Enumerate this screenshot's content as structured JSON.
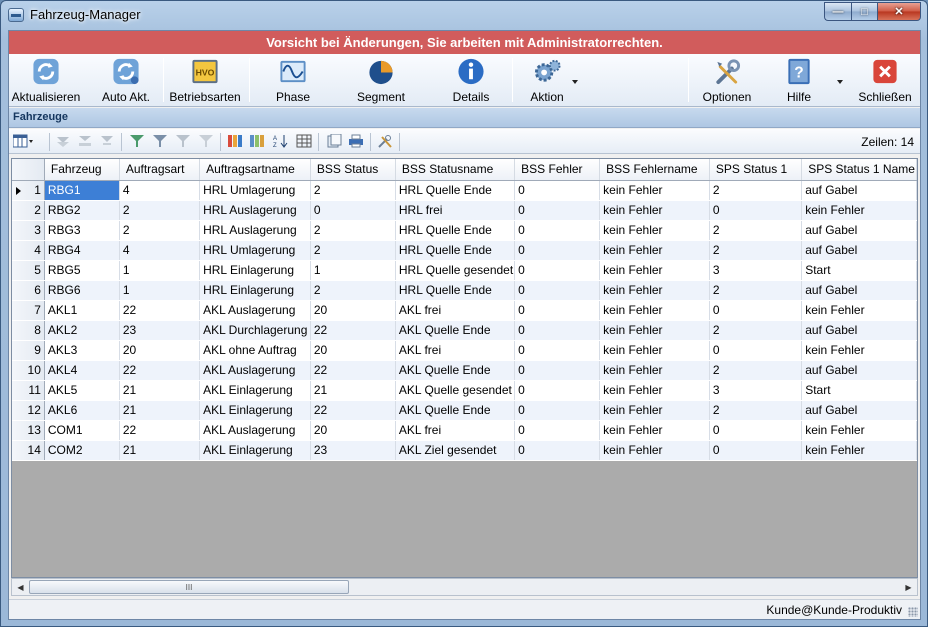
{
  "window": {
    "title": "Fahrzeug-Manager"
  },
  "warning": "Vorsicht bei Änderungen, Sie arbeiten mit Administratorrechten.",
  "toolbar": {
    "aktualisieren": "Aktualisieren",
    "auto_akt": "Auto Akt.",
    "betriebsarten": "Betriebsarten",
    "phase": "Phase",
    "segment": "Segment",
    "details": "Details",
    "aktion": "Aktion",
    "optionen": "Optionen",
    "hilfe": "Hilfe",
    "schliessen": "Schließen",
    "hvo_icon_text": "HVO"
  },
  "section": {
    "title": "Fahrzeuge"
  },
  "grid_toolbar": {
    "rows_label": "Zeilen: 14"
  },
  "table": {
    "columns": [
      "Fahrzeug",
      "Auftragsart",
      "Auftragsartname",
      "BSS Status",
      "BSS Statusname",
      "BSS Fehler",
      "BSS Fehlername",
      "SPS Status 1",
      "SPS Status 1 Name"
    ],
    "rows": [
      [
        "1",
        "RBG1",
        "4",
        "HRL Umlagerung",
        "2",
        "HRL Quelle Ende",
        "0",
        "kein Fehler",
        "2",
        "auf Gabel"
      ],
      [
        "2",
        "RBG2",
        "2",
        "HRL Auslagerung",
        "0",
        "HRL frei",
        "0",
        "kein Fehler",
        "0",
        "kein Fehler"
      ],
      [
        "3",
        "RBG3",
        "2",
        "HRL Auslagerung",
        "2",
        "HRL Quelle Ende",
        "0",
        "kein Fehler",
        "2",
        "auf Gabel"
      ],
      [
        "4",
        "RBG4",
        "4",
        "HRL Umlagerung",
        "2",
        "HRL Quelle Ende",
        "0",
        "kein Fehler",
        "2",
        "auf Gabel"
      ],
      [
        "5",
        "RBG5",
        "1",
        "HRL Einlagerung",
        "1",
        "HRL Quelle gesendet",
        "0",
        "kein Fehler",
        "3",
        "Start"
      ],
      [
        "6",
        "RBG6",
        "1",
        "HRL Einlagerung",
        "2",
        "HRL Quelle Ende",
        "0",
        "kein Fehler",
        "2",
        "auf Gabel"
      ],
      [
        "7",
        "AKL1",
        "22",
        "AKL Auslagerung",
        "20",
        "AKL frei",
        "0",
        "kein Fehler",
        "0",
        "kein Fehler"
      ],
      [
        "8",
        "AKL2",
        "23",
        "AKL Durchlagerung",
        "22",
        "AKL Quelle Ende",
        "0",
        "kein Fehler",
        "2",
        "auf Gabel"
      ],
      [
        "9",
        "AKL3",
        "20",
        "AKL ohne Auftrag",
        "20",
        "AKL frei",
        "0",
        "kein Fehler",
        "0",
        "kein Fehler"
      ],
      [
        "10",
        "AKL4",
        "22",
        "AKL Auslagerung",
        "22",
        "AKL Quelle Ende",
        "0",
        "kein Fehler",
        "2",
        "auf Gabel"
      ],
      [
        "11",
        "AKL5",
        "21",
        "AKL Einlagerung",
        "21",
        "AKL Quelle gesendet",
        "0",
        "kein Fehler",
        "3",
        "Start"
      ],
      [
        "12",
        "AKL6",
        "21",
        "AKL Einlagerung",
        "22",
        "AKL Quelle Ende",
        "0",
        "kein Fehler",
        "2",
        "auf Gabel"
      ],
      [
        "13",
        "COM1",
        "22",
        "AKL Auslagerung",
        "20",
        "AKL frei",
        "0",
        "kein Fehler",
        "0",
        "kein Fehler"
      ],
      [
        "14",
        "COM2",
        "21",
        "AKL Einlagerung",
        "23",
        "AKL Ziel gesendet",
        "0",
        "kein Fehler",
        "0",
        "kein Fehler"
      ]
    ]
  },
  "scrollbar": {
    "thumb_grip": "III"
  },
  "status": {
    "user": "Kunde@Kunde-Produktiv"
  },
  "colors": {
    "warning": "#d15c5c",
    "selection": "#3d7fd6",
    "alt_row": "#eef3fb"
  }
}
